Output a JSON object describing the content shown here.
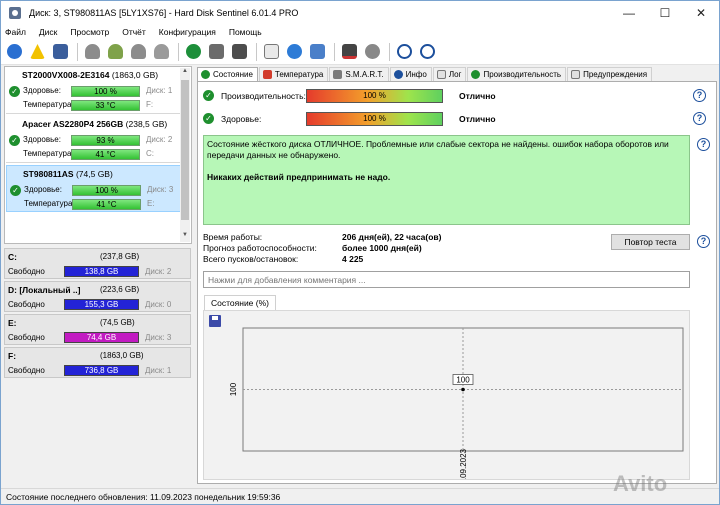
{
  "window": {
    "title": "Диск: 3, ST980811AS [5LY1XS76]  -  Hard Disk Sentinel 6.01.4 PRO",
    "minimize": "—",
    "maximize": "☐",
    "close": "✕"
  },
  "menu": [
    "Файл",
    "Диск",
    "Просмотр",
    "Отчёт",
    "Конфигурация",
    "Помощь"
  ],
  "toolbar_icons": [
    "refresh-icon",
    "warning-icon",
    "report-icon",
    "disk-test-icon",
    "disk-test-2-icon",
    "disk-test-3-icon",
    "disk-test-4-icon",
    "globe-icon",
    "network-icon",
    "usb-icon",
    "document-icon",
    "recycle-icon",
    "options-icon",
    "monitor-icon",
    "sound-icon",
    "help-icon",
    "info-icon"
  ],
  "disks": [
    {
      "name": "ST2000VX008-2E3164",
      "size": "(1863,0 GB)",
      "health_label": "Здоровье:",
      "health": "100 %",
      "temp_label": "Температура:",
      "temp": "33 °C",
      "disk_ref": "Диск: 1",
      "vol_ref": "F:"
    },
    {
      "name": "Apacer AS2280P4 256GB",
      "size": "(238,5 GB)",
      "health_label": "Здоровье:",
      "health": "93 %",
      "temp_label": "Температура:",
      "temp": "41 °C",
      "disk_ref": "Диск: 2",
      "vol_ref": "C:"
    },
    {
      "name": "ST980811AS",
      "size": "(74,5 GB)",
      "health_label": "Здоровье:",
      "health": "100 %",
      "temp_label": "Температура:",
      "temp": "41 °C",
      "disk_ref": "Диск: 3",
      "vol_ref": "E:"
    }
  ],
  "volumes": [
    {
      "letter": "C:",
      "size": "(237,8 GB)",
      "free_label": "Свободно",
      "free": "138,8 GB",
      "disk_ref": "Диск: 2",
      "color": "#2323d6"
    },
    {
      "letter": "D: [Локальный ..]",
      "size": "(223,6 GB)",
      "free_label": "Свободно",
      "free": "155,3 GB",
      "disk_ref": "Диск: 0",
      "color": "#2323d6"
    },
    {
      "letter": "E:",
      "size": "(74,5 GB)",
      "free_label": "Свободно",
      "free": "74,4 GB",
      "disk_ref": "Диск: 3",
      "color": "#c21bc2"
    },
    {
      "letter": "F:",
      "size": "(1863,0 GB)",
      "free_label": "Свободно",
      "free": "736,8 GB",
      "disk_ref": "Диск: 1",
      "color": "#2323d6"
    }
  ],
  "tabs": [
    "Состояние",
    "Температура",
    "S.M.A.R.T.",
    "Инфо",
    "Лог",
    "Производительность",
    "Предупреждения"
  ],
  "status": {
    "performance_label": "Производительность:",
    "performance": "100 %",
    "performance_state": "Отлично",
    "health_label": "Здоровье:",
    "health": "100 %",
    "health_state": "Отлично"
  },
  "description": {
    "line1": "Состояние жёсткого диска ОТЛИЧНОЕ. Проблемные или слабые сектора не найдены. ошибок набора оборотов или передачи данных не обнаружено.",
    "line2": "Никаких действий предпринимать не надо."
  },
  "info": {
    "uptime_label": "Время работы:",
    "uptime": "206 дня(ей), 22 часа(ов)",
    "forecast_label": "Прогноз работоспособности:",
    "forecast": "более 1000 дня(ей)",
    "starts_label": "Всего пусков/остановок:",
    "starts": "4 225"
  },
  "retest_button": "Повтор теста",
  "comment_placeholder": "Нажми для добавления комментария ...",
  "chart_tab": "Состояние (%)",
  "chart_data": {
    "type": "line",
    "x": [
      "11.09.2023"
    ],
    "series": [
      {
        "values": [
          100
        ]
      }
    ],
    "point_label": "100",
    "y_tick": "100",
    "x_tick": "11.09.2023"
  },
  "statusbar": "Состояние последнего обновления: 11.09.2023 понедельник 19:59:36",
  "watermark": "Avito"
}
